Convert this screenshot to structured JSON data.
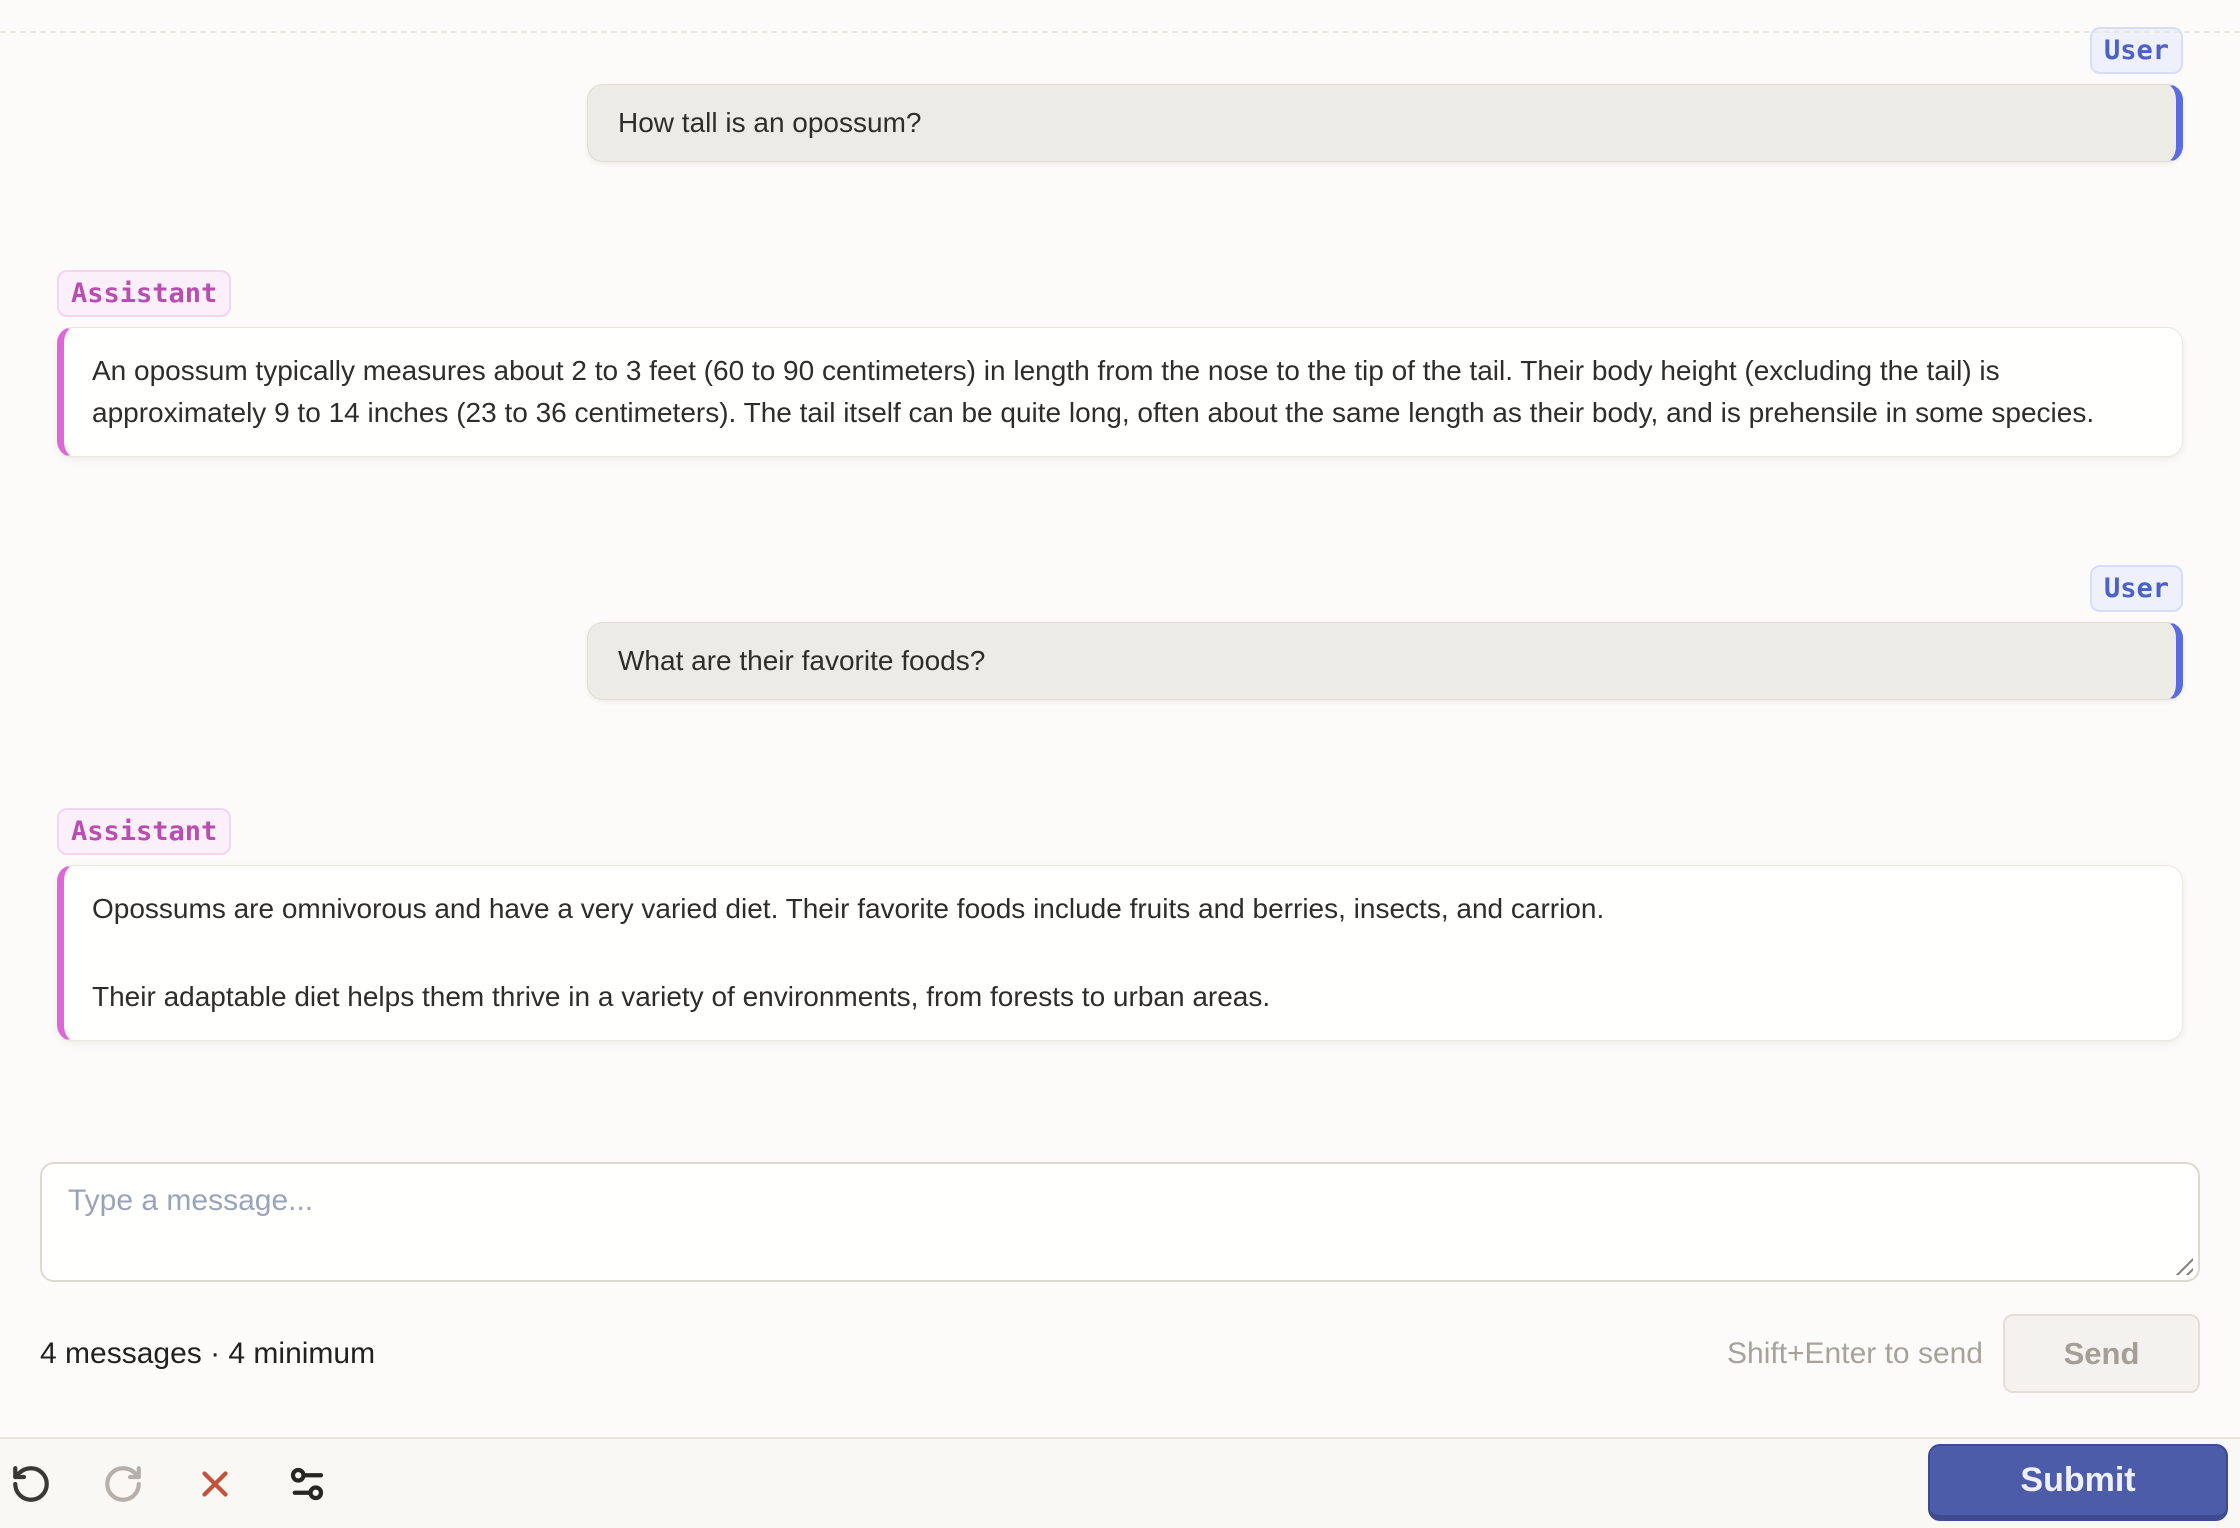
{
  "messages": [
    {
      "role": "User",
      "paragraphs": [
        "How tall is an opossum?"
      ]
    },
    {
      "role": "Assistant",
      "paragraphs": [
        "An opossum typically measures about 2 to 3 feet (60 to 90 centimeters) in length from the nose to the tip of the tail. Their body height (excluding the tail) is approximately 9 to 14 inches (23 to 36 centimeters). The tail itself can be quite long, often about the same length as their body, and is prehensile in some species."
      ]
    },
    {
      "role": "User",
      "paragraphs": [
        "What are their favorite foods?"
      ]
    },
    {
      "role": "Assistant",
      "paragraphs": [
        "Opossums are omnivorous and have a very varied diet. Their favorite foods include fruits and berries, insects, and carrion.",
        "Their adaptable diet helps them thrive in a variety of environments, from forests to urban areas."
      ]
    }
  ],
  "composer": {
    "placeholder": "Type a message...",
    "value": "",
    "status": "4 messages · 4 minimum",
    "hint": "Shift+Enter to send",
    "send_label": "Send"
  },
  "toolbar": {
    "icons": [
      "undo-icon",
      "redo-icon",
      "close-icon",
      "settings-sliders-icon"
    ],
    "submit_label": "Submit"
  },
  "colors": {
    "user_accent": "#5b6ce0",
    "assistant_accent": "#dd67d7",
    "user_badge_text": "#4c60c6",
    "assistant_badge_text": "#b94eb1",
    "submit_bg": "#4d5ca9",
    "close_icon": "#c0543e",
    "page_bg": "#fcfbf9"
  }
}
